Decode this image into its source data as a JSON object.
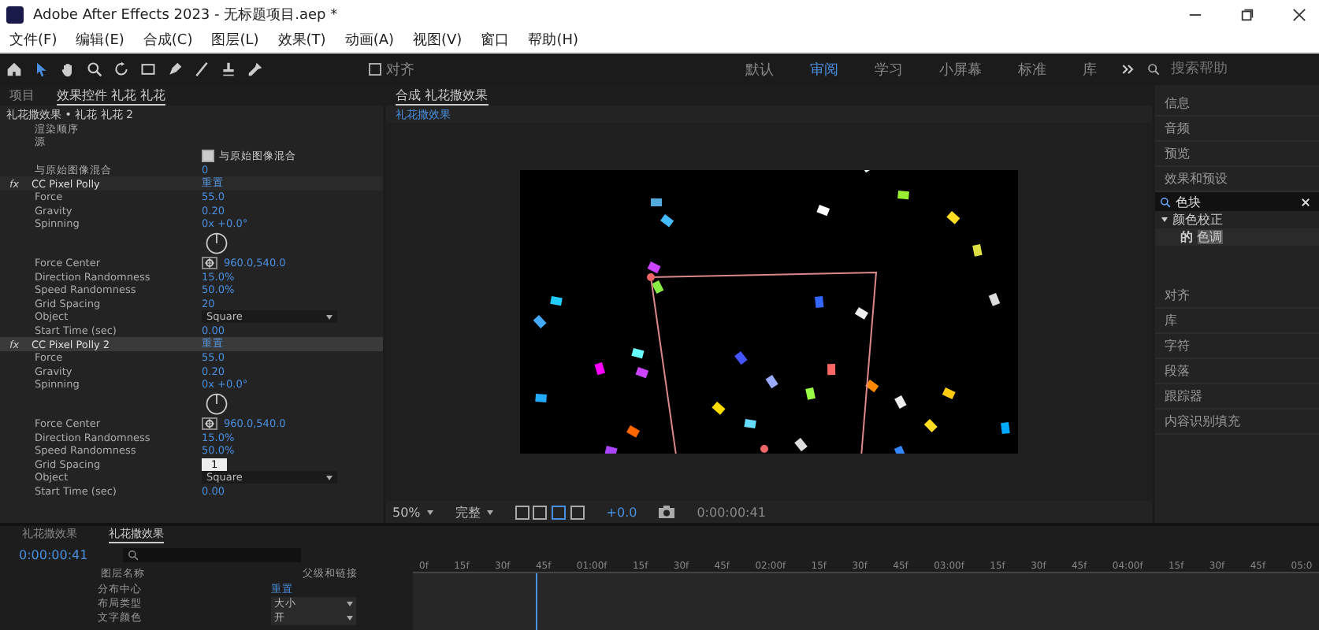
{
  "window": {
    "title": "Adobe After Effects 2023 - 无标题项目.aep *"
  },
  "menu": [
    "文件(F)",
    "编辑(E)",
    "合成(C)",
    "图层(L)",
    "效果(T)",
    "动画(A)",
    "视图(V)",
    "窗口",
    "帮助(H)"
  ],
  "toolbar": {
    "snap_label": "对齐",
    "snap_checked": false
  },
  "workspaces": [
    {
      "label": "默认",
      "selected": false
    },
    {
      "label": "审阅",
      "selected": true
    },
    {
      "label": "学习",
      "selected": false
    },
    {
      "label": "小屏幕",
      "selected": false
    },
    {
      "label": "标准",
      "selected": false
    },
    {
      "label": "库",
      "selected": false
    }
  ],
  "help_search": {
    "placeholder": "搜索帮助"
  },
  "left_panel": {
    "tabs": [
      {
        "label": "项目",
        "selected": false
      },
      {
        "label": "效果控件 礼花 礼花",
        "selected": true
      }
    ],
    "header": "礼花撒效果 • 礼花 礼花 2",
    "rows": [
      {
        "kind": "prop",
        "label": "渲染顺序",
        "value": ""
      },
      {
        "kind": "prop",
        "label": "源",
        "value": ""
      },
      {
        "kind": "check",
        "label": "",
        "value": "与原始图像混合",
        "checked": true
      },
      {
        "kind": "prop",
        "label": "与原始图像混合",
        "value": "0"
      },
      {
        "kind": "fx",
        "label": "CC Pixel Polly",
        "value": "重置",
        "selected": false
      },
      {
        "kind": "prop",
        "label": "Force",
        "value": "55.0"
      },
      {
        "kind": "prop",
        "label": "Gravity",
        "value": "0.20"
      },
      {
        "kind": "prop",
        "label": "Spinning",
        "value": "0x +0.0°"
      },
      {
        "kind": "dial"
      },
      {
        "kind": "point",
        "label": "Force Center",
        "value": "960.0,540.0"
      },
      {
        "kind": "prop",
        "label": "Direction Randomness",
        "value": "15.0%"
      },
      {
        "kind": "prop",
        "label": "Speed Randomness",
        "value": "50.0%"
      },
      {
        "kind": "prop",
        "label": "Grid Spacing",
        "value": "20"
      },
      {
        "kind": "select",
        "label": "Object",
        "value": "Square"
      },
      {
        "kind": "prop",
        "label": "Start Time (sec)",
        "value": "0.00"
      },
      {
        "kind": "fx",
        "label": "CC Pixel Polly 2",
        "value": "重置",
        "selected": true
      },
      {
        "kind": "prop",
        "label": "Force",
        "value": "55.0"
      },
      {
        "kind": "prop",
        "label": "Gravity",
        "value": "0.20"
      },
      {
        "kind": "prop",
        "label": "Spinning",
        "value": "0x +0.0°"
      },
      {
        "kind": "dial"
      },
      {
        "kind": "point",
        "label": "Force Center",
        "value": "960.0,540.0"
      },
      {
        "kind": "prop",
        "label": "Direction Randomness",
        "value": "15.0%"
      },
      {
        "kind": "prop",
        "label": "Speed Randomness",
        "value": "50.0%"
      },
      {
        "kind": "edit",
        "label": "Grid Spacing",
        "value": "1"
      },
      {
        "kind": "select",
        "label": "Object",
        "value": "Square"
      },
      {
        "kind": "prop",
        "label": "Start Time (sec)",
        "value": "0.00"
      }
    ]
  },
  "viewer": {
    "tab": "合成 礼花撒效果",
    "subtab": "礼花撒效果",
    "zoom": "50%",
    "quality": "完整",
    "exposure": "+0.0",
    "time": "0:00:00:41"
  },
  "right_panel": {
    "items_top": [
      "信息",
      "音频",
      "预览",
      "效果和预设"
    ],
    "search": {
      "value": "色块"
    },
    "tree": {
      "label": "颜色校正",
      "expanded": true,
      "children": [
        {
          "label": "色调",
          "prefix": "的"
        }
      ]
    },
    "items_bottom": [
      "对齐",
      "库",
      "字符",
      "段落",
      "跟踪器",
      "内容识别填充"
    ]
  },
  "timeline": {
    "tabs": [
      {
        "label": "礼花撒效果",
        "selected": false
      },
      {
        "label": "礼花撒效果",
        "selected": true
      }
    ],
    "time": "0:00:00:41",
    "ruler": [
      "0f",
      "15f",
      "30f",
      "45f",
      "01:00f",
      "15f",
      "30f",
      "45f",
      "02:00f",
      "15f",
      "30f",
      "45f",
      "03:00f",
      "15f",
      "30f",
      "45f",
      "04:00f",
      "15f",
      "30f",
      "45f",
      "05:0"
    ],
    "columns": [
      "图层名称",
      "父级和链接"
    ],
    "rows": [
      {
        "kind": "group",
        "label": "分布中心",
        "value": "重置"
      },
      {
        "kind": "select",
        "label": "布局类型",
        "value": "大小"
      },
      {
        "kind": "select",
        "label": "文字颜色",
        "value": "开"
      }
    ]
  }
}
